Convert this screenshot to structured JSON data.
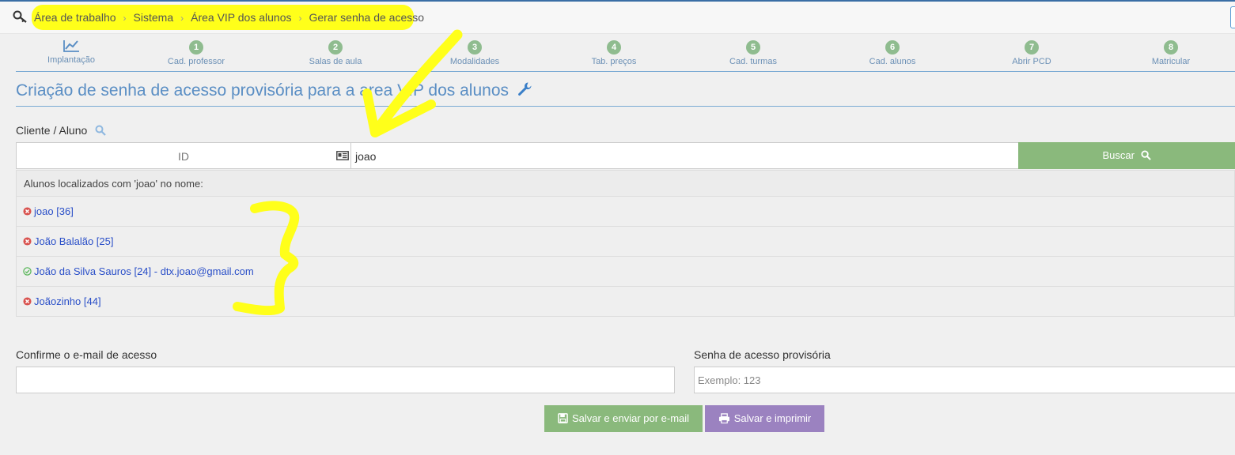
{
  "breadcrumb": [
    "Área de trabalho",
    "Sistema",
    "Área VIP dos alunos",
    "Gerar senha de acesso"
  ],
  "wizard": {
    "steps": [
      {
        "num": "",
        "label": "Implantação"
      },
      {
        "num": "1",
        "label": "Cad. professor"
      },
      {
        "num": "2",
        "label": "Salas de aula"
      },
      {
        "num": "3",
        "label": "Modalidades"
      },
      {
        "num": "4",
        "label": "Tab. preços"
      },
      {
        "num": "5",
        "label": "Cad. turmas"
      },
      {
        "num": "6",
        "label": "Cad. alunos"
      },
      {
        "num": "7",
        "label": "Abrir PCD"
      },
      {
        "num": "8",
        "label": "Matricular"
      }
    ]
  },
  "page_title": "Criação de senha de acesso provisória para a area VIP dos alunos",
  "client": {
    "label": "Cliente / Aluno",
    "id_placeholder": "ID",
    "name_value": "joao",
    "search_button": "Buscar"
  },
  "results": {
    "header": "Alunos localizados com 'joao' no nome:",
    "items": [
      {
        "text": "joao [36]",
        "status": "error"
      },
      {
        "text": "João Balalão [25]",
        "status": "error"
      },
      {
        "text": "João da Silva Sauros [24] - dtx.joao@gmail.com",
        "status": "ok"
      },
      {
        "text": "Joãozinho [44]",
        "status": "error"
      }
    ]
  },
  "form": {
    "confirm_email_label": "Confirme o e-mail de acesso",
    "confirm_email_value": "",
    "temp_password_label": "Senha de acesso provisória",
    "temp_password_placeholder": "Exemplo: 123"
  },
  "actions": {
    "save_email": "Salvar e enviar por e-mail",
    "save_print": "Salvar e imprimir"
  },
  "colors": {
    "accent_blue": "#5a8ec4",
    "green_button": "#8ab97c",
    "purple_button": "#9b82c0",
    "highlight_yellow": "#ffff1a",
    "error_red": "#d9534f",
    "ok_green": "#5cb85c"
  }
}
